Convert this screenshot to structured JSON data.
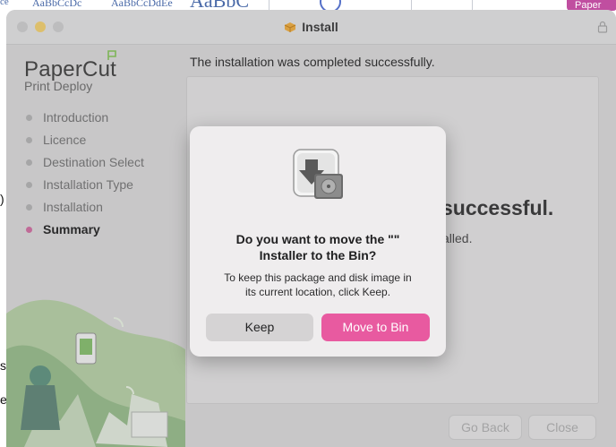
{
  "desktop": {
    "frag1": "ce",
    "frag2": "AaBbCcDc",
    "frag3": "AaBbCcDdEe",
    "frag4": "AaBbC",
    "badge": "Paper",
    "left_frag_1": ")",
    "left_frag_2": "s",
    "left_frag_3": "e"
  },
  "window": {
    "title": "Install",
    "title_icon": "package-icon",
    "lock_icon": "lock-icon"
  },
  "sidebar": {
    "brand": "PaperCut",
    "brand_sub": "Print Deploy",
    "steps": [
      {
        "label": "Introduction",
        "active": false
      },
      {
        "label": "Licence",
        "active": false
      },
      {
        "label": "Destination Select",
        "active": false
      },
      {
        "label": "Installation Type",
        "active": false
      },
      {
        "label": "Installation",
        "active": false
      },
      {
        "label": "Summary",
        "active": true
      }
    ],
    "accent_color": "#c06a97"
  },
  "main": {
    "headline": "The installation was completed successfully.",
    "success_fragment": "successful.",
    "installed_fragment": "alled."
  },
  "footer": {
    "go_back": "Go Back",
    "close": "Close"
  },
  "dialog": {
    "icon": "installer-trash-icon",
    "title_line1": "Do you want to move the \"\"",
    "title_line2": "Installer to the Bin?",
    "message_line1": "To keep this package and disk image in",
    "message_line2": "its current location, click Keep.",
    "keep": "Keep",
    "move_to_bin": "Move to Bin",
    "primary_color": "#e85aa0"
  }
}
